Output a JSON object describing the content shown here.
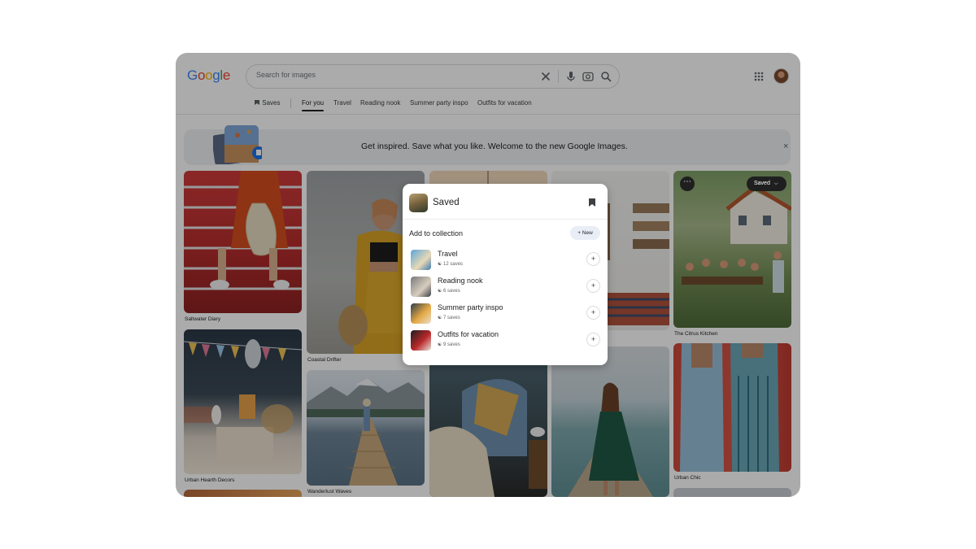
{
  "app": {
    "logo_text": "Google",
    "logo_colors": [
      "#4285F4",
      "#EA4335",
      "#FBBC05",
      "#4285F4",
      "#34A853",
      "#EA4335"
    ]
  },
  "search": {
    "placeholder": "Search for images",
    "icons": [
      "close-icon",
      "microphone-icon",
      "camera-lens-icon",
      "search-icon"
    ]
  },
  "header": {
    "apps_icon": "apps-grid-icon",
    "avatar_icon": "avatar"
  },
  "tabs": {
    "saves_label": "Saves",
    "items": [
      {
        "label": "For you",
        "active": true
      },
      {
        "label": "Travel",
        "active": false
      },
      {
        "label": "Reading nook",
        "active": false
      },
      {
        "label": "Summer party inspo",
        "active": false
      },
      {
        "label": "Outfits for vacation",
        "active": false
      }
    ]
  },
  "banner": {
    "text": "Get inspired. Save what you like. Welcome to the new Google Images.",
    "close": "×"
  },
  "grid": {
    "captions": {
      "c1": "Saltwater Diary",
      "c2": "Urban Hearth Decors",
      "c3": "Coastal Drifter",
      "c4": "Wanderlust Waves",
      "c5": "The Citrus Kitchen",
      "c6": "Urban Chic"
    },
    "saved_button": "Saved",
    "more_button": "⋯"
  },
  "popup": {
    "title": "Saved",
    "add_to_collection": "Add to collection",
    "new_button": "New",
    "collections": [
      {
        "name": "Travel",
        "saves": "12 saves"
      },
      {
        "name": "Reading nook",
        "saves": "6 saves"
      },
      {
        "name": "Summer party inspo",
        "saves": "7 saves"
      },
      {
        "name": "Outfits for vacation",
        "saves": "9 saves"
      }
    ]
  },
  "colors": {
    "accent": "#1a73e8",
    "overlay": "rgba(0,0,0,0.33)"
  }
}
